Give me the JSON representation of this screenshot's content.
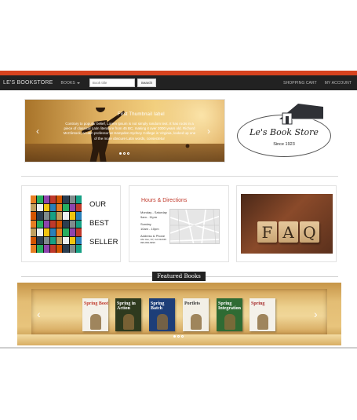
{
  "navbar": {
    "brand": "LE'S BOOKSTORE",
    "books_label": "BOOKS",
    "search_placeholder": "Book title",
    "search_button": "Search",
    "cart_label": "SHOPPING CART",
    "account_label": "MY ACCOUNT"
  },
  "hero": {
    "caption": "First Thumbnail label",
    "text": "Contrary to popular belief, Lorem Ipsum is not simply random text. It has roots in a piece of classical Latin literature from 45 BC, making it over 2000 years old. Richard McClintock, a Latin professor at Hampden-Sydney College in Virginia, looked up one of the more obscure Latin words, consectetur"
  },
  "logo": {
    "title": "Le's Book Store",
    "subtitle": "Since 1923"
  },
  "bestseller": {
    "words": [
      "OUR",
      "BEST",
      "SELLER"
    ]
  },
  "hours": {
    "title": "Hours & Directions",
    "weekday_label": "Monday - Saturday",
    "weekday_hours": "9am - 11pm",
    "sunday_label": "Sunday",
    "sunday_hours": "10am - 10pm",
    "address_label": "Address & Phone",
    "address_line": "Abc Ave, NY, CA 912345",
    "phone": "999-999-9999"
  },
  "faq": {
    "letters": [
      "F",
      "A",
      "Q"
    ]
  },
  "featured": {
    "label": "Featured Books",
    "books": [
      {
        "title": "Spring Boot",
        "color": "#f4f1ea",
        "title_color": "#c0392b"
      },
      {
        "title": "Spring in Action",
        "color": "#2e3a1e",
        "title_color": "#ffffff"
      },
      {
        "title": "Spring Batch",
        "color": "#1d3e78",
        "title_color": "#ffffff"
      },
      {
        "title": "Portlets",
        "color": "#f2efe6",
        "title_color": "#333333"
      },
      {
        "title": "Spring Integration",
        "color": "#2f6b33",
        "title_color": "#ffffff"
      },
      {
        "title": "Spring",
        "color": "#f4f1ea",
        "title_color": "#a52a2a"
      }
    ]
  },
  "colors": {
    "accent": "#d6431f",
    "navbar_bg": "#222222",
    "hours_title": "#c0392b"
  }
}
